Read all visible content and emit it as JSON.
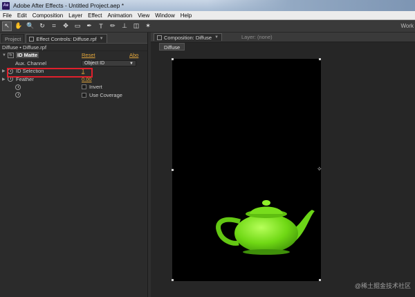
{
  "window": {
    "title": "Adobe After Effects - Untitled Project.aep *",
    "app_icon": "Ae"
  },
  "menu": [
    "File",
    "Edit",
    "Composition",
    "Layer",
    "Effect",
    "Animation",
    "View",
    "Window",
    "Help"
  ],
  "toolbar": {
    "tools": [
      "selection-tool",
      "hand-tool",
      "zoom-tool",
      "rotation-tool",
      "camera-tool",
      "pan-behind-tool",
      "rectangle-tool",
      "pen-tool",
      "type-tool",
      "brush-tool",
      "clone-stamp-tool",
      "eraser-tool",
      "puppet-tool"
    ],
    "glyphs": [
      "↖",
      "✋",
      "🔍",
      "↻",
      "⌗",
      "✥",
      "▭",
      "✒",
      "T",
      "✏",
      "⊥",
      "◫",
      "✶"
    ],
    "workspace_label": "Work"
  },
  "effect_controls": {
    "project_tab": "Project",
    "tab_label": "Effect Controls: Diffuse.rpf",
    "breadcrumb": "Diffuse • Diffuse.rpf",
    "effect_name": "ID Matte",
    "reset_label": "Reset",
    "about_label": "Abo",
    "fx_badge": "fx",
    "properties": {
      "aux_channel": {
        "label": "Aux. Channel",
        "value": "Object ID"
      },
      "id_selection": {
        "label": "ID Selection",
        "value": "1"
      },
      "feather": {
        "label": "Feather",
        "value": "0.00"
      },
      "invert": {
        "label": "Invert"
      },
      "use_coverage": {
        "label": "Use Coverage"
      }
    }
  },
  "composition": {
    "tab_label": "Composition: Diffuse",
    "layer_tab": "Layer: (none)",
    "sub_tab": "Diffuse",
    "teapot_color": "#7ee41c"
  },
  "watermark": "@稀土掘金技术社区"
}
